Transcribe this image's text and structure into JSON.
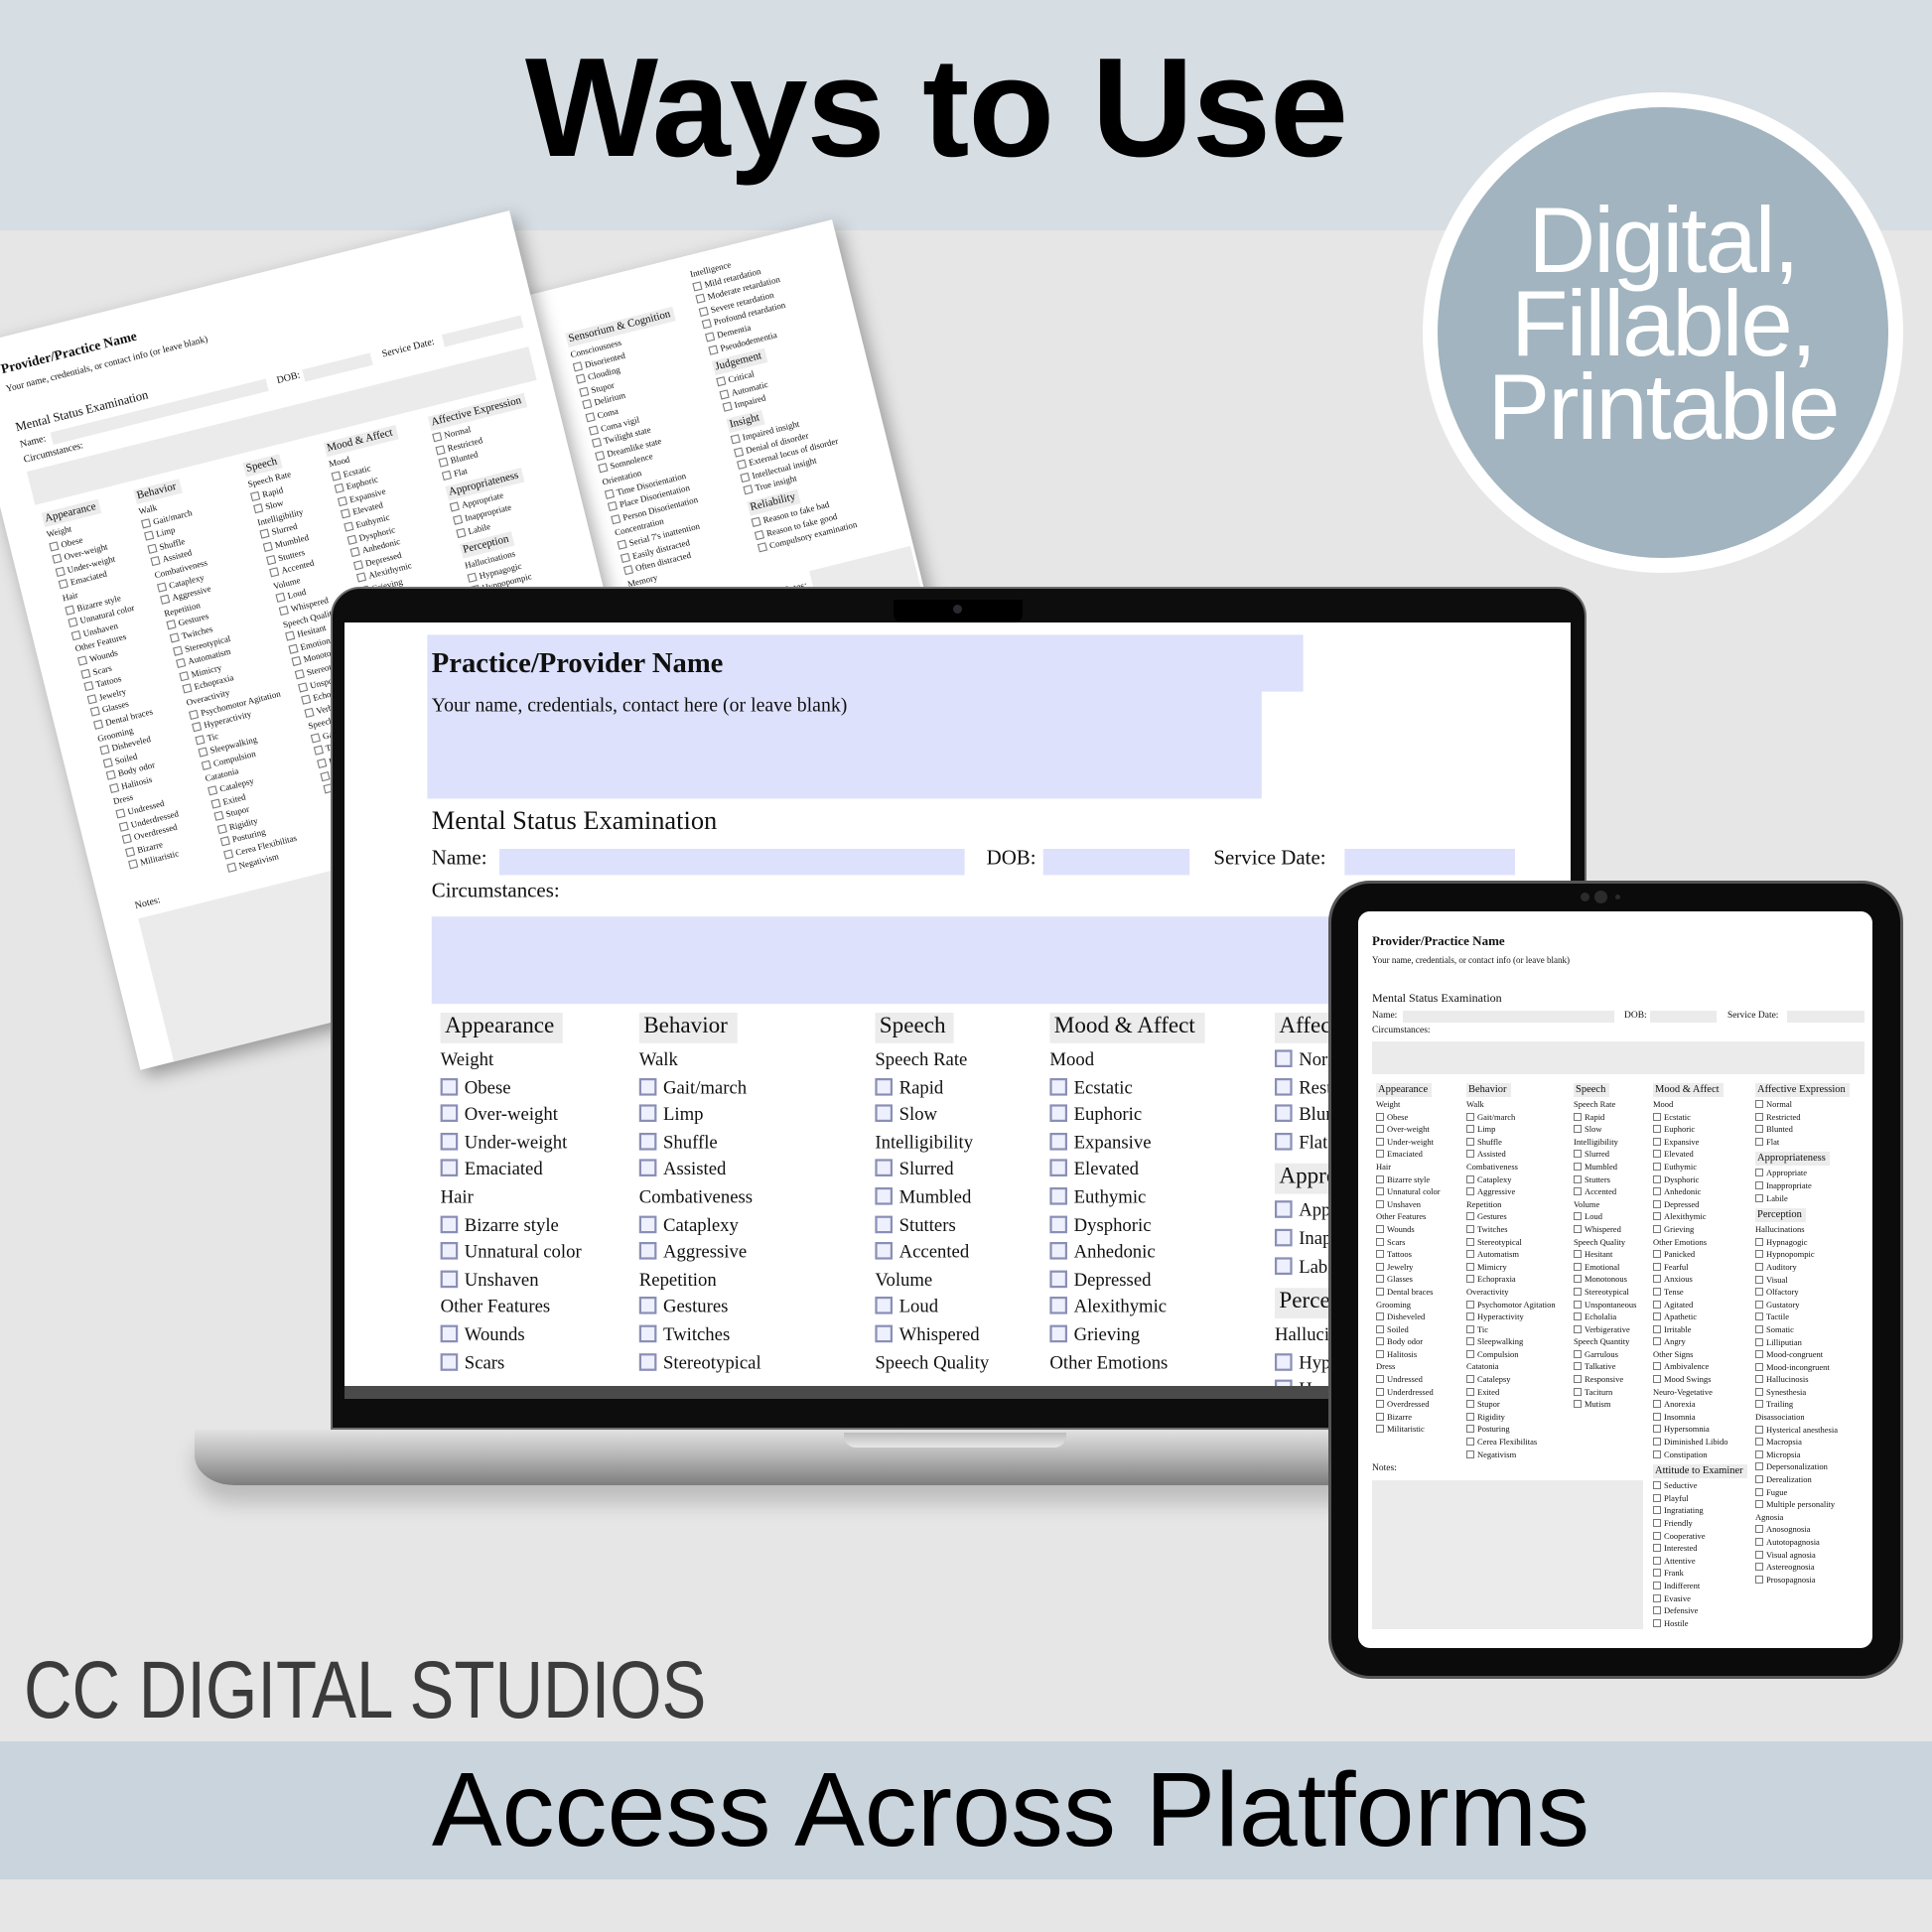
{
  "header": {
    "title": "Ways to Use"
  },
  "badge": {
    "lines": [
      "Digital,",
      "Fillable,",
      "Printable"
    ]
  },
  "brand": "CC DIGITAL STUDIOS",
  "footer": {
    "tagline": "Access Across Platforms"
  },
  "colors": {
    "top_band": "#d6dde3",
    "background": "#e6e6e6",
    "badge": "#a1b4bf",
    "bottom_band": "#c9d4dd",
    "field_gray": "#ebebeb",
    "field_lavender": "#dde1fb"
  },
  "form": {
    "tablet_title": "Provider/Practice Name",
    "tablet_subtitle": "Your name, credentials, or contact info (or leave blank)",
    "laptop_title": "Practice/Provider Name",
    "laptop_subtitle": "Your name, credentials, contact here (or leave blank)",
    "exam_title": "Mental Status Examination",
    "labels": {
      "name": "Name:",
      "dob": "DOB:",
      "service_date": "Service Date:",
      "circumstances": "Circumstances:",
      "notes": "Notes:"
    },
    "columns": [
      [
        [
          "h",
          "Appearance"
        ],
        [
          "g",
          "Weight"
        ],
        [
          "i",
          "Obese"
        ],
        [
          "i",
          "Over-weight"
        ],
        [
          "i",
          "Under-weight"
        ],
        [
          "i",
          "Emaciated"
        ],
        [
          "g",
          "Hair"
        ],
        [
          "i",
          "Bizarre style"
        ],
        [
          "i",
          "Unnatural color"
        ],
        [
          "i",
          "Unshaven"
        ],
        [
          "g",
          "Other Features"
        ],
        [
          "i",
          "Wounds"
        ],
        [
          "i",
          "Scars"
        ],
        [
          "i",
          "Tattoos"
        ],
        [
          "i",
          "Jewelry"
        ],
        [
          "i",
          "Glasses"
        ],
        [
          "i",
          "Dental braces"
        ],
        [
          "g",
          "Grooming"
        ],
        [
          "i",
          "Disheveled"
        ],
        [
          "i",
          "Soiled"
        ],
        [
          "i",
          "Body odor"
        ],
        [
          "i",
          "Halitosis"
        ],
        [
          "g",
          "Dress"
        ],
        [
          "i",
          "Undressed"
        ],
        [
          "i",
          "Underdressed"
        ],
        [
          "i",
          "Overdressed"
        ],
        [
          "i",
          "Bizarre"
        ],
        [
          "i",
          "Militaristic"
        ]
      ],
      [
        [
          "h",
          "Behavior"
        ],
        [
          "g",
          "Walk"
        ],
        [
          "i",
          "Gait/march"
        ],
        [
          "i",
          "Limp"
        ],
        [
          "i",
          "Shuffle"
        ],
        [
          "i",
          "Assisted"
        ],
        [
          "g",
          "Combativeness"
        ],
        [
          "i",
          "Cataplexy"
        ],
        [
          "i",
          "Aggressive"
        ],
        [
          "g",
          "Repetition"
        ],
        [
          "i",
          "Gestures"
        ],
        [
          "i",
          "Twitches"
        ],
        [
          "i",
          "Stereotypical"
        ],
        [
          "i",
          "Automatism"
        ],
        [
          "i",
          "Mimicry"
        ],
        [
          "i",
          "Echopraxia"
        ],
        [
          "g",
          "Overactivity"
        ],
        [
          "i",
          "Psychomotor Agitation"
        ],
        [
          "i",
          "Hyperactivity"
        ],
        [
          "i",
          "Tic"
        ],
        [
          "i",
          "Sleepwalking"
        ],
        [
          "i",
          "Compulsion"
        ],
        [
          "g",
          "Catatonia"
        ],
        [
          "i",
          "Catalepsy"
        ],
        [
          "i",
          "Exited"
        ],
        [
          "i",
          "Stupor"
        ],
        [
          "i",
          "Rigidity"
        ],
        [
          "i",
          "Posturing"
        ],
        [
          "i",
          "Cerea Flexibilitas"
        ],
        [
          "i",
          "Negativism"
        ]
      ],
      [
        [
          "h",
          "Speech"
        ],
        [
          "g",
          "Speech Rate"
        ],
        [
          "i",
          "Rapid"
        ],
        [
          "i",
          "Slow"
        ],
        [
          "g",
          "Intelligibility"
        ],
        [
          "i",
          "Slurred"
        ],
        [
          "i",
          "Mumbled"
        ],
        [
          "i",
          "Stutters"
        ],
        [
          "i",
          "Accented"
        ],
        [
          "g",
          "Volume"
        ],
        [
          "i",
          "Loud"
        ],
        [
          "i",
          "Whispered"
        ],
        [
          "g",
          "Speech Quality"
        ],
        [
          "i",
          "Hesitant"
        ],
        [
          "i",
          "Emotional"
        ],
        [
          "i",
          "Monotonous"
        ],
        [
          "i",
          "Stereotypical"
        ],
        [
          "i",
          "Unspontaneous"
        ],
        [
          "i",
          "Echolalia"
        ],
        [
          "i",
          "Verbigerative"
        ],
        [
          "g",
          "Speech Quantity"
        ],
        [
          "i",
          "Garrulous"
        ],
        [
          "i",
          "Talkative"
        ],
        [
          "i",
          "Responsive"
        ],
        [
          "i",
          "Taciturn"
        ],
        [
          "i",
          "Mutism"
        ]
      ],
      [
        [
          "h",
          "Mood & Affect"
        ],
        [
          "g",
          "Mood"
        ],
        [
          "i",
          "Ecstatic"
        ],
        [
          "i",
          "Euphoric"
        ],
        [
          "i",
          "Expansive"
        ],
        [
          "i",
          "Elevated"
        ],
        [
          "i",
          "Euthymic"
        ],
        [
          "i",
          "Dysphoric"
        ],
        [
          "i",
          "Anhedonic"
        ],
        [
          "i",
          "Depressed"
        ],
        [
          "i",
          "Alexithymic"
        ],
        [
          "i",
          "Grieving"
        ],
        [
          "g",
          "Other Emotions"
        ],
        [
          "i",
          "Panicked"
        ],
        [
          "i",
          "Fearful"
        ],
        [
          "i",
          "Anxious"
        ],
        [
          "i",
          "Tense"
        ],
        [
          "i",
          "Agitated"
        ],
        [
          "i",
          "Apathetic"
        ],
        [
          "i",
          "Irritable"
        ],
        [
          "i",
          "Angry"
        ],
        [
          "g",
          "Other Signs"
        ],
        [
          "i",
          "Ambivalence"
        ],
        [
          "i",
          "Mood Swings"
        ],
        [
          "g",
          "Neuro-Vegetative"
        ],
        [
          "i",
          "Anorexia"
        ],
        [
          "i",
          "Insomnia"
        ],
        [
          "i",
          "Hypersomnia"
        ],
        [
          "i",
          "Diminished Libido"
        ],
        [
          "i",
          "Constipation"
        ],
        [
          "h",
          "Attitude to Examiner"
        ],
        [
          "i",
          "Seductive"
        ],
        [
          "i",
          "Playful"
        ],
        [
          "i",
          "Ingratiating"
        ],
        [
          "i",
          "Friendly"
        ],
        [
          "i",
          "Cooperative"
        ],
        [
          "i",
          "Interested"
        ],
        [
          "i",
          "Attentive"
        ],
        [
          "i",
          "Frank"
        ],
        [
          "i",
          "Indifferent"
        ],
        [
          "i",
          "Evasive"
        ],
        [
          "i",
          "Defensive"
        ],
        [
          "i",
          "Hostile"
        ]
      ],
      [
        [
          "h",
          "Affective Expression"
        ],
        [
          "i",
          "Normal"
        ],
        [
          "i",
          "Restricted"
        ],
        [
          "i",
          "Blunted"
        ],
        [
          "i",
          "Flat"
        ],
        [
          "h",
          "Appropriateness"
        ],
        [
          "i",
          "Appropriate"
        ],
        [
          "i",
          "Inappropriate"
        ],
        [
          "i",
          "Labile"
        ],
        [
          "h",
          "Perception"
        ],
        [
          "g",
          "Hallucinations"
        ],
        [
          "i",
          "Hypnagogic"
        ],
        [
          "i",
          "Hypnopompic"
        ],
        [
          "i",
          "Auditory"
        ],
        [
          "i",
          "Visual"
        ],
        [
          "i",
          "Olfactory"
        ],
        [
          "i",
          "Gustatory"
        ],
        [
          "i",
          "Tactile"
        ],
        [
          "i",
          "Somatic"
        ],
        [
          "i",
          "Lilliputian"
        ],
        [
          "i",
          "Mood-congruent"
        ],
        [
          "i",
          "Mood-incongruent"
        ],
        [
          "i",
          "Hallucinosis"
        ],
        [
          "i",
          "Synesthesia"
        ],
        [
          "i",
          "Trailing"
        ],
        [
          "g",
          "Disassociation"
        ],
        [
          "i",
          "Hysterical anesthesia"
        ],
        [
          "i",
          "Macropsia"
        ],
        [
          "i",
          "Micropsia"
        ],
        [
          "i",
          "Depersonalization"
        ],
        [
          "i",
          "Derealization"
        ],
        [
          "i",
          "Fugue"
        ],
        [
          "i",
          "Multiple personality"
        ],
        [
          "g",
          "Agnosia"
        ],
        [
          "i",
          "Anosognosia"
        ],
        [
          "i",
          "Autotopagnosia"
        ],
        [
          "i",
          "Visual agnosia"
        ],
        [
          "i",
          "Astereognosia"
        ],
        [
          "i",
          "Prosopagnosia"
        ]
      ]
    ],
    "page2_columns": [
      [
        [
          "h",
          "Sensorium & Cognition"
        ],
        [
          "g",
          "Consciousness"
        ],
        [
          "i",
          "Disoriented"
        ],
        [
          "i",
          "Clouding"
        ],
        [
          "i",
          "Stupor"
        ],
        [
          "i",
          "Delirium"
        ],
        [
          "i",
          "Coma"
        ],
        [
          "i",
          "Coma vigil"
        ],
        [
          "i",
          "Twilight state"
        ],
        [
          "i",
          "Dreamlike state"
        ],
        [
          "i",
          "Somnolence"
        ],
        [
          "g",
          "Orientation"
        ],
        [
          "i",
          "Time Disorientation"
        ],
        [
          "i",
          "Place Disorientation"
        ],
        [
          "i",
          "Person Disorientation"
        ],
        [
          "g",
          "Concentration"
        ],
        [
          "i",
          "Serial 7's inattention"
        ],
        [
          "i",
          "Easily distracted"
        ],
        [
          "i",
          "Often distracted"
        ],
        [
          "g",
          "Memory"
        ]
      ],
      [
        [
          "g",
          "Intelligence"
        ],
        [
          "i",
          "Mild retardation"
        ],
        [
          "i",
          "Moderate retardation"
        ],
        [
          "i",
          "Severe retardation"
        ],
        [
          "i",
          "Profound retardation"
        ],
        [
          "i",
          "Dementia"
        ],
        [
          "i",
          "Pseudodementia"
        ],
        [
          "h",
          "Judgement"
        ],
        [
          "i",
          "Critical"
        ],
        [
          "i",
          "Automatic"
        ],
        [
          "i",
          "Impaired"
        ],
        [
          "h",
          "Insight"
        ],
        [
          "i",
          "Impaired insight"
        ],
        [
          "i",
          "Denial of disorder"
        ],
        [
          "i",
          "External locus of disorder"
        ],
        [
          "i",
          "Intellectual insight"
        ],
        [
          "i",
          "True insight"
        ],
        [
          "h",
          "Reliability"
        ],
        [
          "i",
          "Reason to fake bad"
        ],
        [
          "i",
          "Reason to fake good"
        ],
        [
          "i",
          "Compulsory examination"
        ]
      ]
    ]
  }
}
